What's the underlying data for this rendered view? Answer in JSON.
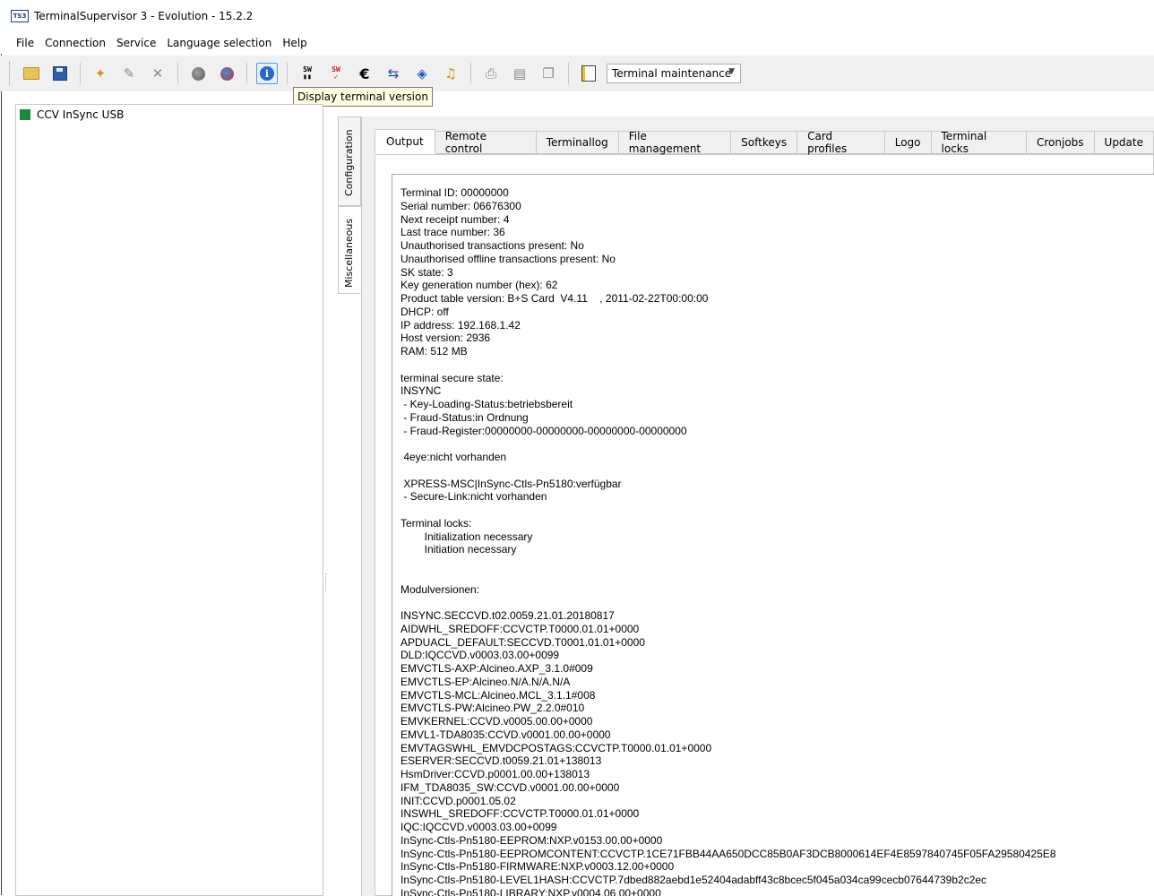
{
  "window": {
    "title": "TerminalSupervisor 3 - Evolution - 15.2.2",
    "icon_text": "TS3"
  },
  "menu": [
    "File",
    "Connection",
    "Service",
    "Language selection",
    "Help"
  ],
  "toolbar": {
    "icons": [
      "open-folder-icon",
      "save-icon",
      "new-icon",
      "edit-icon",
      "delete-icon",
      "disconnect-icon",
      "connect-icon",
      "info-icon",
      "software-download-icon",
      "software-update-icon",
      "euro-icon",
      "transfer-icon",
      "log-icon",
      "diagnostics-icon",
      "print-icon",
      "receipt-icon",
      "window-icon",
      "book-icon"
    ],
    "sw_label": "SW",
    "euro_label": "€",
    "mode_dropdown": "Terminal maintenance",
    "tooltip": "Display terminal version"
  },
  "sidebar": {
    "device": "CCV InSync USB",
    "status_color": "#178a3c"
  },
  "vertical_tabs": [
    "Configuration",
    "Miscellaneous"
  ],
  "tabs": [
    "Output",
    "Remote control",
    "Terminallog",
    "File management",
    "Softkeys",
    "Card profiles",
    "Logo",
    "Terminal locks",
    "Cronjobs",
    "Update"
  ],
  "active_tab": "Output",
  "output_text": "Terminal ID: 00000000\nSerial number: 06676300\nNext receipt number: 4\nLast trace number: 36\nUnauthorised transactions present: No\nUnauthorised offline transactions present: No\nSK state: 3\nKey generation number (hex): 62\nProduct table version: B+S Card  V4.11    , 2011-02-22T00:00:00\nDHCP: off\nIP address: 192.168.1.42\nHost version: 2936\nRAM: 512 MB\n\nterminal secure state:\nINSYNC\n - Key-Loading-Status:betriebsbereit\n - Fraud-Status:in Ordnung\n - Fraud-Register:00000000-00000000-00000000-00000000\n\n 4eye:nicht vorhanden\n\n XPRESS-MSC|InSync-Ctls-Pn5180:verfügbar\n - Secure-Link:nicht vorhanden\n\nTerminal locks:\n        Initialization necessary\n        Initiation necessary\n\n\nModulversionen:\n\nINSYNC.SECCVD.t02.0059.21.01.20180817\nAIDWHL_SREDOFF:CCVCTP.T0000.01.01+0000\nAPDUACL_DEFAULT:SECCVD.T0001.01.01+0000\nDLD:IQCCVD.v0003.03.00+0099\nEMVCTLS-AXP:Alcineo.AXP_3.1.0#009\nEMVCTLS-EP:Alcineo.N/A.N/A.N/A\nEMVCTLS-MCL:Alcineo.MCL_3.1.1#008\nEMVCTLS-PW:Alcineo.PW_2.2.0#010\nEMVKERNEL:CCVD.v0005.00.00+0000\nEMVL1-TDA8035:CCVD.v0001.00.00+0000\nEMVTAGSWHL_EMVDCPOSTAGS:CCVCTP.T0000.01.01+0000\nESERVER:SECCVD.t0059.21.01+138013\nHsmDriver:CCVD.p0001.00.00+138013\nIFM_TDA8035_SW:CCVD.v0001.00.00+0000\nINIT:CCVD.p0001.05.02\nINSWHL_SREDOFF:CCVCTP.T0000.01.01+0000\nIQC:IQCCVD.v0003.03.00+0099\nInSync-Ctls-Pn5180-EEPROM:NXP.v0153.00.00+0000\nInSync-Ctls-Pn5180-EEPROMCONTENT:CCVCTP.1CE71FBB44AA650DCC85B0AF3DCB8000614EF4E8597840745F05FA29580425E8\nInSync-Ctls-Pn5180-FIRMWARE:NXP.v0003.12.00+0000\nInSync-Ctls-Pn5180-LEVEL1HASH:CCVCTP.7dbed882aebd1e52404adabff43c8bcec5f045a034ca99cecb07644739b2c2ec\nInSync-Ctls-Pn5180-LIBRARY:NXP.v0004.06.00+0000"
}
